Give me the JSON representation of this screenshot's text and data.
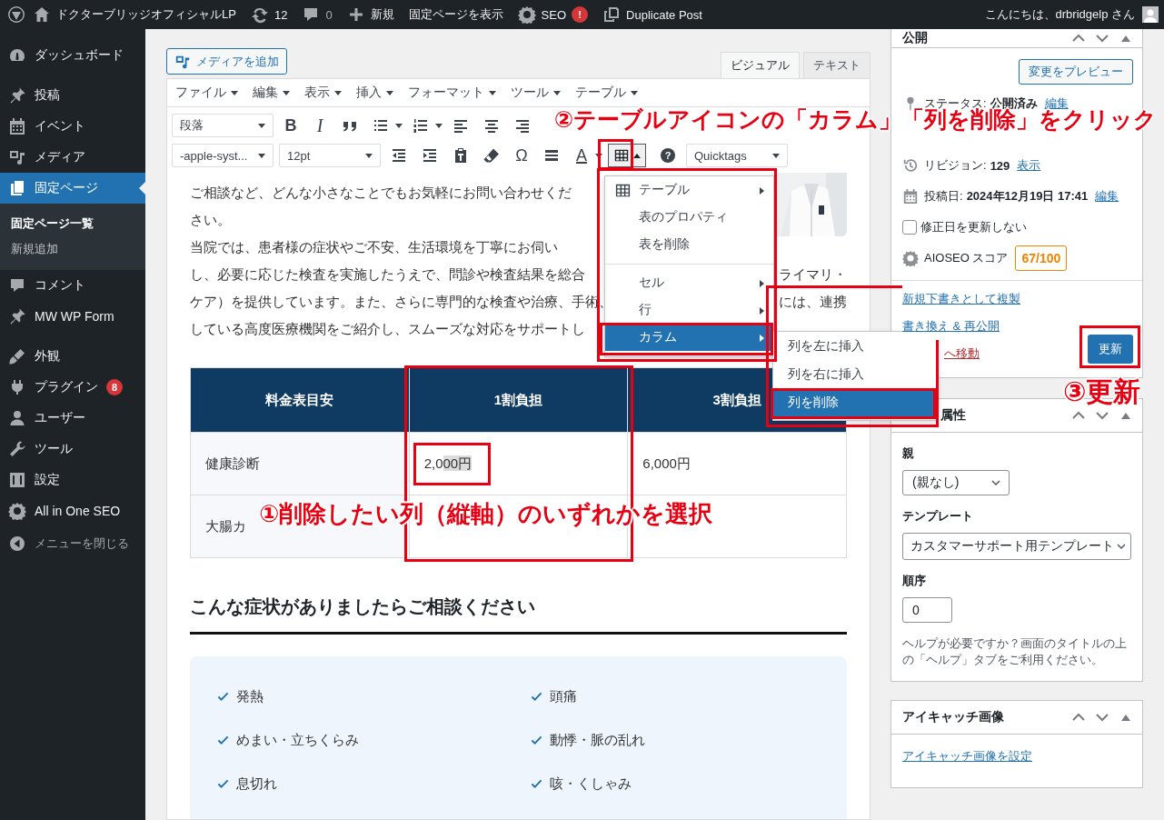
{
  "admin_bar": {
    "site_name": "ドクターブリッジオフィシャルLP",
    "updates": "12",
    "comments": "0",
    "new": "新規",
    "view_page": "固定ページを表示",
    "seo": "SEO",
    "seo_badge": "!",
    "duplicate": "Duplicate Post",
    "greeting": "こんにちは、drbridgelp さん"
  },
  "sidebar": {
    "groups": [
      [
        {
          "label": "ダッシュボード",
          "selected": false
        }
      ],
      [
        {
          "label": "投稿",
          "selected": false
        },
        {
          "label": "イベント",
          "selected": false
        },
        {
          "label": "メディア",
          "selected": false
        },
        {
          "label": "固定ページ",
          "selected": true,
          "children": [
            {
              "label": "固定ページ一覧",
              "selected": true
            },
            {
              "label": "新規追加",
              "selected": false
            }
          ]
        },
        {
          "label": "コメント",
          "selected": false
        },
        {
          "label": "MW WP Form",
          "selected": false
        }
      ],
      [
        {
          "label": "外観",
          "selected": false
        },
        {
          "label": "プラグイン",
          "selected": false,
          "badge": "8"
        },
        {
          "label": "ユーザー",
          "selected": false
        },
        {
          "label": "ツール",
          "selected": false
        },
        {
          "label": "設定",
          "selected": false
        },
        {
          "label": "All in One SEO",
          "selected": false
        }
      ]
    ],
    "collapse": "メニューを閉じる"
  },
  "editor": {
    "add_media": "メディアを追加",
    "tabs": [
      {
        "label": "ビジュアル",
        "selected": true
      },
      {
        "label": "テキスト",
        "selected": false
      }
    ],
    "menubar": [
      "ファイル",
      "編集",
      "表示",
      "挿入",
      "フォーマット",
      "ツール",
      "テーブル"
    ],
    "toolbar": {
      "format_select": "段落",
      "bold": "B",
      "italic": "I",
      "font_select": "-apple-syst...",
      "size_select": "12pt",
      "special_char": "Ω",
      "text_color": "A",
      "table_button_pressed": true,
      "help": "?",
      "quicktags_select": "Quicktags"
    },
    "paragraph_lines": [
      {
        "text": "ご相談など、どんな小さなことでもお気軽にお問い合わせくだ"
      },
      {
        "text": "さい。"
      },
      {
        "text": "当院では、患者様の症状やご不安、生活環境を丁寧にお伺い"
      },
      {
        "text": "し、必要に応じた検査を実施したうえで、問診や検査結果を総合",
        "text_right": "ライマリ・"
      },
      {
        "text": "ケア）を提供しています。また、さらに専門的な検査や治療、手術、",
        "text_right": "には、連携"
      },
      {
        "text": "している高度医療機関をご紹介し、スムーズな対応をサポートし"
      }
    ],
    "table": {
      "columns": [
        "料金表目安",
        "1割負担",
        "3割負担"
      ],
      "rows": [
        [
          {
            "text": "健康診断"
          },
          {
            "text": "2,0",
            "highlighted": "00円"
          },
          {
            "text": "6,000円"
          }
        ],
        [
          {
            "text": "大腸カ"
          }
        ]
      ]
    },
    "heading": "こんな症状がありましたらご相談ください",
    "symptoms": [
      "発熱",
      "頭痛",
      "めまい・立ちくらみ",
      "動悸・脈の乱れ",
      "息切れ",
      "咳・くしゃみ"
    ]
  },
  "table_menu": {
    "groups": [
      [
        {
          "label": "テーブル",
          "has_submenu": true,
          "selected": false
        },
        {
          "label": "表のプロパティ",
          "has_submenu": false,
          "selected": false
        },
        {
          "label": "表を削除",
          "has_submenu": false,
          "selected": false
        }
      ],
      [
        {
          "label": "セル",
          "has_submenu": true,
          "selected": false
        },
        {
          "label": "行",
          "has_submenu": true,
          "selected": false
        },
        {
          "label": "カラム",
          "has_submenu": true,
          "selected": true
        }
      ]
    ],
    "submenu": [
      {
        "label": "列を左に挿入",
        "selected": false
      },
      {
        "label": "列を右に挿入",
        "selected": false
      },
      {
        "label": "列を削除",
        "selected": true
      }
    ]
  },
  "publish": {
    "title": "公開",
    "preview": "変更をプレビュー",
    "status_label": "ステータス:",
    "status_value": "公開済み",
    "status_link": "編集",
    "revisions_label": "リビジョン:",
    "revisions_value": "129",
    "revisions_link": "表示",
    "date_label": "投稿日:",
    "date_value": "2024年12月19日 17:41",
    "date_link": "編集",
    "keep_date": {
      "label": "修正日を更新しない",
      "checked": false
    },
    "seo_label": "AIOSEO スコア",
    "seo_score": "67/100",
    "links": [
      "新規下書きとして複製",
      "書き換え & 再公開"
    ],
    "trash": "へ移動",
    "update": "更新"
  },
  "page_attributes": {
    "title": "属性",
    "parent_label": "親",
    "parent_value": "(親なし)",
    "template_label": "テンプレート",
    "template_value": "カスタマーサポート用テンプレート",
    "order_label": "順序",
    "order_value": "0",
    "help": "ヘルプが必要ですか？画面のタイトルの上の「ヘルプ」タブをご利用ください。"
  },
  "featured_image": {
    "title": "アイキャッチ画像",
    "link": "アイキャッチ画像を設定"
  },
  "annotations": [
    "①削除したい列（縦軸）のいずれかを選択",
    "②テーブルアイコンの「カラム」「列を削除」をクリック",
    "③更新"
  ]
}
